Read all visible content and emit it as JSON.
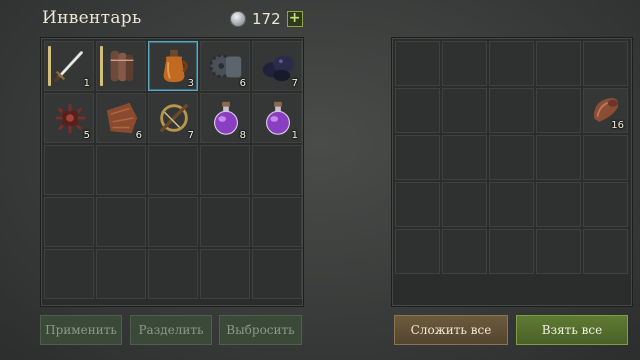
{
  "header": {
    "title": "Инвентарь",
    "coins": "172",
    "plus": "+"
  },
  "inventory": {
    "slots": [
      {
        "name": "sword",
        "qty": "1",
        "durability": true,
        "selected": false
      },
      {
        "name": "leather-bundle",
        "qty": "",
        "durability": true,
        "selected": false
      },
      {
        "name": "jug",
        "qty": "3",
        "durability": false,
        "selected": true
      },
      {
        "name": "coal-chunk",
        "qty": "6",
        "durability": false,
        "selected": false
      },
      {
        "name": "dark-ore",
        "qty": "7",
        "durability": false,
        "selected": false
      },
      {
        "name": "red-fiber",
        "qty": "5",
        "durability": false,
        "selected": false
      },
      {
        "name": "leather-scrap",
        "qty": "6",
        "durability": false,
        "selected": false
      },
      {
        "name": "crossbow",
        "qty": "7",
        "durability": false,
        "selected": false
      },
      {
        "name": "purple-potion",
        "qty": "8",
        "durability": false,
        "selected": false
      },
      {
        "name": "purple-potion",
        "qty": "1",
        "durability": false,
        "selected": false
      }
    ],
    "total_slots": 25
  },
  "stash": {
    "slots": [
      {
        "index": 9,
        "name": "leather-roll",
        "qty": "16"
      }
    ],
    "total_slots": 25
  },
  "buttons": {
    "use": "Применить",
    "split": "Разделить",
    "drop": "Выбросить",
    "stack_all": "Сложить все",
    "take_all": "Взять все"
  }
}
